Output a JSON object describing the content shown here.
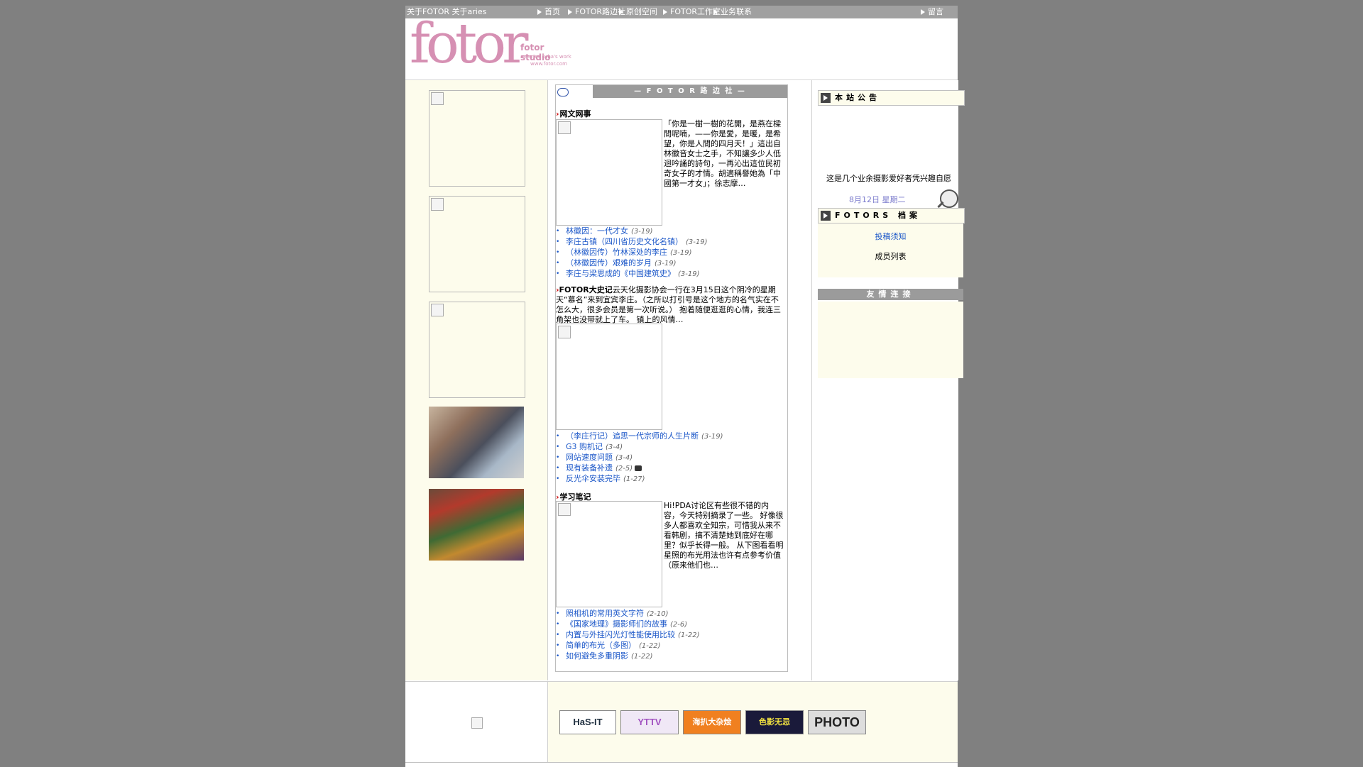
{
  "topnav": {
    "about": "关于FOTOR 关于aries",
    "items": [
      "首页",
      "FOTOR路边社",
      "原创空间",
      "FOTOR工作室",
      "业务联系",
      "留言"
    ]
  },
  "logo": {
    "main": "fotor",
    "sub1": "fotor studio",
    "sub2": "an aries suha's work",
    "sub3": "www.fotor.com"
  },
  "center": {
    "header_title": "— F O T O R 路 边 社 —",
    "section1": {
      "title": "网文网事",
      "excerpt": "「你是一樹一樹的花開，是燕在樑間呢喃，——你是愛，是暖，是希望，你是人間的四月天！」這出自林徽音女士之手，不知讓多少人低迴吟誦的詩句，一再沁出這位民初奇女子的才情。胡適稱譽她為「中國第一才女」；徐志摩…",
      "links": [
        {
          "text": "林徽因：一代才女",
          "date": "(3-19)"
        },
        {
          "text": "李庄古镇（四川省历史文化名镇）",
          "date": "(3-19)"
        },
        {
          "text": "（林徽因传）竹林深处的李庄",
          "date": "(3-19)"
        },
        {
          "text": "（林徽因传）艰难的岁月",
          "date": "(3-19)"
        },
        {
          "text": "李庄与梁思成的《中国建筑史》",
          "date": "(3-19)"
        }
      ]
    },
    "section2": {
      "title": "FOTOR大史记",
      "excerpt": "云天化摄影协会一行在3月15日这个阴冷的星期天“慕名”来到宜宾李庄。（之所以打引号是这个地方的名气实在不怎么大，很多会员是第一次听说。） 抱着随便逛逛的心情，我连三角架也没带就上了车。 镇上的风情…",
      "links": [
        {
          "text": "（李庄行记）追思一代宗师的人生片断",
          "date": "(3-19)"
        },
        {
          "text": "G3 购机记",
          "date": "(3-4)"
        },
        {
          "text": "网站速度问题",
          "date": "(3-4)"
        },
        {
          "text": "现有装备补遗",
          "date": "(2-5)"
        },
        {
          "text": "反光伞安装完毕",
          "date": "(1-27)"
        }
      ]
    },
    "section3": {
      "title": "学习笔记",
      "excerpt": "Hi!PDA讨论区有些很不错的内容，今天特别摘录了一些。 好像很多人都喜欢全知宗，可惜我从来不看韩剧，搞不清楚她到底好在哪里？似乎长得一般。 从下图看看明星照的布光用法也许有点参考价值（原来他们也…",
      "links": [
        {
          "text": "照相机的常用英文字符",
          "date": "(2-10)"
        },
        {
          "text": "《国家地理》摄影师们的故事",
          "date": "(2-6)"
        },
        {
          "text": "内置与外挂闪光灯性能使用比较",
          "date": "(1-22)"
        },
        {
          "text": "简单的布光（多图）",
          "date": "(1-22)"
        },
        {
          "text": "如何避免多重阴影",
          "date": "(1-22)"
        }
      ]
    }
  },
  "right": {
    "notice_title": "本站公告",
    "notice_text": "这是几个业余摄影爱好者凭兴趣自愿走在的家园",
    "date_line": "8月12日 星期二",
    "archive_title": "FOTORS 档案",
    "archive_links": [
      "投稿须知",
      "成员列表"
    ],
    "friends_title": "友情连接"
  },
  "footer": {
    "banners": [
      "HaS-IT",
      "YTTV",
      "海扒大杂烩",
      "色影无忌",
      "PHOTO"
    ]
  }
}
